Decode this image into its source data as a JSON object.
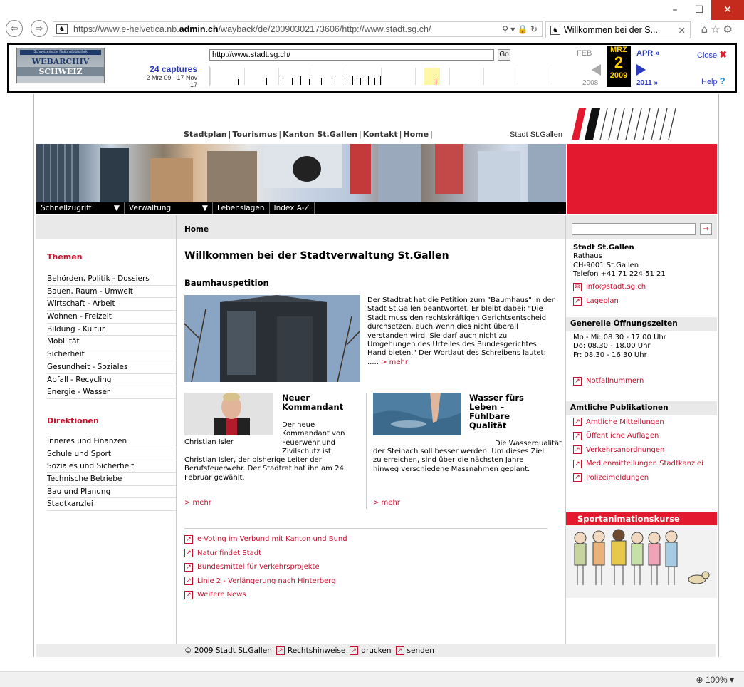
{
  "browser": {
    "url_prefix": "https://www.e-helvetica.nb.",
    "url_domain": "admin.ch",
    "url_rest": "/wayback/de/20090302173606/http://www.stadt.sg.ch/",
    "tab_title": "Willkommen bei der S...",
    "addr_controls": "⚲ ▾ 🔒 ↻",
    "zoom": "100%"
  },
  "wayback": {
    "logo_line1": "Schweizerische Nationalbibliothek",
    "logo_line2": "WEBARCHIV",
    "logo_line3": "SCHWEIZ",
    "captures": "24 captures",
    "capture_range": "2 Mrz 09 - 17 Nov 17",
    "url_value": "http://www.stadt.sg.ch/",
    "go_label": "Go",
    "prev_month": "FEB",
    "cur_month": "MRZ",
    "next_month": "APR »",
    "cur_day": "2",
    "prev_year": "2008",
    "cur_year": "2009",
    "next_year": "2011 »",
    "close_label": "Close",
    "help_label": "Help"
  },
  "site": {
    "topnav": [
      "Stadtplan",
      "Tourismus",
      "Kanton St.Gallen",
      "Kontakt",
      "Home"
    ],
    "stadt_label": "Stadt St.Gallen",
    "menu": [
      "Schnellzugriff",
      "Verwaltung",
      "Lebenslagen",
      "Index A-Z"
    ],
    "breadcrumb": "Home",
    "search_btn": "→"
  },
  "left": {
    "themen_title": "Themen",
    "themen": [
      "Behörden, Politik - Dossiers",
      "Bauen, Raum - Umwelt",
      "Wirtschaft - Arbeit",
      "Wohnen - Freizeit",
      "Bildung - Kultur",
      "Mobilität",
      "Sicherheit",
      "Gesundheit - Soziales",
      "Abfall - Recycling",
      "Energie - Wasser"
    ],
    "direktionen_title": "Direktionen",
    "direktionen": [
      "Inneres und Finanzen",
      "Schule und Sport",
      "Soziales und Sicherheit",
      "Technische Betriebe",
      "Bau und Planung",
      "Stadtkanzlei"
    ]
  },
  "main": {
    "title": "Willkommen bei der Stadtverwaltung St.Gallen",
    "petition_title": "Baumhauspetition",
    "petition_text": "Der Stadtrat hat die Petition zum \"Baumhaus\" in der Stadt St.Gallen beantwortet. Er bleibt dabei: \"Die Stadt muss den rechtskräftigen Gerichtsentscheid durchsetzen, auch wenn dies nicht überall verstanden wird. Sie darf auch nicht zu Umgehungen des Urteiles des Bundesgerichtes Hand bieten.\" Der Wortlaut des Schreibens lautet: .....",
    "mehr": "> mehr",
    "news1_title": "Neuer Kommandant",
    "news1_caption": "Christian Isler",
    "news1_text_a": "Der neue Kommandant von Feuerwehr und Zivilschutz ist",
    "news1_text_b": "Christian Isler, der bisherige Leiter der Berufsfeuerwehr. Der Stadtrat hat ihn am 24. Februar gewählt.",
    "news2_title": "Wasser fürs Leben – Fühlbare Qualität",
    "news2_text_a": "Die Wasserqualität",
    "news2_text_b": "der Steinach soll besser werden. Um dieses Ziel zu erreichen, sind über die nächsten Jahre hinweg verschiedene Massnahmen geplant.",
    "links": [
      "e-Voting im Verbund mit Kanton und Bund",
      "Natur findet Stadt",
      "Bundesmittel für Verkehrsprojekte",
      "Linie 2 - Verlängerung nach Hinterberg",
      "Weitere News"
    ]
  },
  "right": {
    "org": "Stadt St.Gallen",
    "addr1": "Rathaus",
    "addr2": "CH-9001 St.Gallen",
    "phone": "Telefon +41 71 224 51 21",
    "email": "info@stadt.sg.ch",
    "lageplan": "Lageplan",
    "hours_title": "Generelle Öffnungszeiten",
    "hours": [
      "Mo - Mi: 08.30 - 17.00 Uhr",
      "Do: 08.30 - 18.00 Uhr",
      "Fr:  08.30 - 16.30 Uhr"
    ],
    "notfall": "Notfallnummern",
    "pub_title": "Amtliche Publikationen",
    "pubs": [
      "Amtliche Mitteilungen",
      "Öffentliche Auflagen",
      "Verkehrsanordnungen",
      "Medienmitteilungen Stadtkanzlei",
      "Polizeimeldungen"
    ],
    "sport_title": "Sportanimationskurse"
  },
  "footer": {
    "copyright": "© 2009 Stadt St.Gallen",
    "links": [
      "Rechtshinweise",
      "drucken",
      "senden"
    ]
  },
  "colors": {
    "accent": "#c8102e",
    "brand_red": "#e31a2f",
    "wayback_yellow": "#ffd200"
  }
}
